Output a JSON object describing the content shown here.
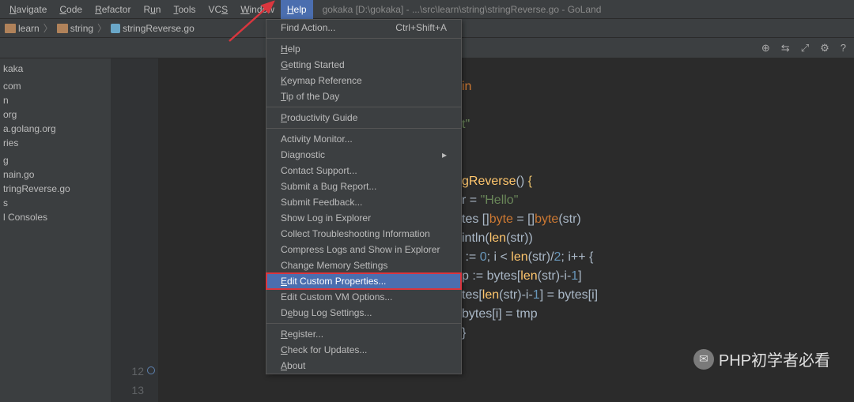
{
  "menubar": {
    "items": [
      {
        "label": "Navigate",
        "u": "N"
      },
      {
        "label": "Code",
        "u": "C"
      },
      {
        "label": "Refactor",
        "u": "R"
      },
      {
        "label": "Run",
        "u": "u",
        "pre": "R"
      },
      {
        "label": "Tools",
        "u": "T"
      },
      {
        "label": "VCS",
        "u": "S",
        "pre": "VC"
      },
      {
        "label": "Window",
        "u": "W"
      },
      {
        "label": "Help",
        "u": "H",
        "active": true
      }
    ],
    "title": "gokaka [D:\\gokaka] - ...\\src\\learn\\string\\stringReverse.go - GoLand"
  },
  "crumbs": {
    "a": "learn",
    "b": "string",
    "c": "stringReverse.go"
  },
  "toolbar_icons": [
    "target-icon",
    "settings-icon",
    "collapse-icon",
    "gear-icon",
    "help-icon"
  ],
  "sidebar": {
    "items": [
      "kaka",
      "",
      "com",
      "n",
      "org",
      "a.golang.org",
      "ries",
      "",
      "g",
      "nain.go",
      "tringReverse.go",
      "s",
      "l Consoles"
    ]
  },
  "dropdown": {
    "items": [
      {
        "label": "Find Action...",
        "short": "Ctrl+Shift+A"
      },
      {
        "sep": true
      },
      {
        "label": "Help",
        "u": "H"
      },
      {
        "label": "Getting Started",
        "u": "G"
      },
      {
        "label": "Keymap Reference",
        "u": "K"
      },
      {
        "label": "Tip of the Day",
        "u": "T"
      },
      {
        "sep": true
      },
      {
        "label": "Productivity Guide",
        "u": "P"
      },
      {
        "sep": true
      },
      {
        "label": "Activity Monitor..."
      },
      {
        "label": "Diagnostic",
        "sub": true
      },
      {
        "label": "Contact Support..."
      },
      {
        "label": "Submit a Bug Report..."
      },
      {
        "label": "Submit Feedback..."
      },
      {
        "label": "Show Log in Explorer"
      },
      {
        "label": "Collect Troubleshooting Information"
      },
      {
        "label": "Compress Logs and Show in Explorer"
      },
      {
        "label": "Change Memory Settings"
      },
      {
        "label": "Edit Custom Properties...",
        "hl": true,
        "u": "E"
      },
      {
        "label": "Edit Custom VM Options..."
      },
      {
        "label": "Debug Log Settings...",
        "u": "e",
        "pre": "D"
      },
      {
        "sep": true
      },
      {
        "label": "Register...",
        "u": "R"
      },
      {
        "label": "Check for Updates...",
        "u": "C"
      },
      {
        "label": "About",
        "u": "A"
      }
    ]
  },
  "gutter": {
    "start": 12,
    "end": 13
  },
  "code": {
    "lines": [
      {
        "frag": [
          {
            "t": "in",
            "c": "kw"
          }
        ]
      },
      {
        "frag": []
      },
      {
        "frag": [
          {
            "t": "t\"",
            "c": "str"
          }
        ]
      },
      {
        "frag": []
      },
      {
        "frag": []
      },
      {
        "frag": [
          {
            "t": "gReverse",
            "c": "fn"
          },
          {
            "t": "() ",
            "c": "pn"
          },
          {
            "t": "{",
            "c": "br"
          }
        ]
      },
      {
        "frag": [
          {
            "t": "r = ",
            "c": "pn"
          },
          {
            "t": "\"Hello\"",
            "c": "str"
          }
        ]
      },
      {
        "frag": [
          {
            "t": "tes []",
            "c": "pn"
          },
          {
            "t": "byte",
            "c": "kw"
          },
          {
            "t": " = []",
            "c": "pn"
          },
          {
            "t": "byte",
            "c": "kw"
          },
          {
            "t": "(str)",
            "c": "pn"
          }
        ]
      },
      {
        "frag": [
          {
            "t": "intln",
            "c": "pn"
          },
          {
            "t": "(",
            "c": "pn"
          },
          {
            "t": "len",
            "c": "fn"
          },
          {
            "t": "(str))",
            "c": "pn"
          }
        ]
      },
      {
        "frag": [
          {
            "t": " := ",
            "c": "pn"
          },
          {
            "t": "0",
            "c": "num"
          },
          {
            "t": "; i < ",
            "c": "pn"
          },
          {
            "t": "len",
            "c": "fn"
          },
          {
            "t": "(str)/",
            "c": "pn"
          },
          {
            "t": "2",
            "c": "num"
          },
          {
            "t": "; i++ {",
            "c": "pn"
          }
        ]
      },
      {
        "frag": [
          {
            "t": "p := bytes[",
            "c": "pn"
          },
          {
            "t": "len",
            "c": "fn"
          },
          {
            "t": "(str)-i-",
            "c": "pn"
          },
          {
            "t": "1",
            "c": "num"
          },
          {
            "t": "]",
            "c": "pn"
          }
        ]
      },
      {
        "frag": [
          {
            "t": "tes[",
            "c": "pn"
          },
          {
            "t": "len",
            "c": "fn"
          },
          {
            "t": "(str)-i-",
            "c": "pn"
          },
          {
            "t": "1",
            "c": "num"
          },
          {
            "t": "] = bytes[i]",
            "c": "pn"
          }
        ]
      },
      {
        "frag": [
          {
            "t": "bytes[i] = tmp",
            "c": "pn"
          }
        ]
      },
      {
        "frag": [
          {
            "t": "}",
            "c": "pn"
          }
        ]
      }
    ]
  },
  "watermark": {
    "text": "PHP初学者必看"
  }
}
